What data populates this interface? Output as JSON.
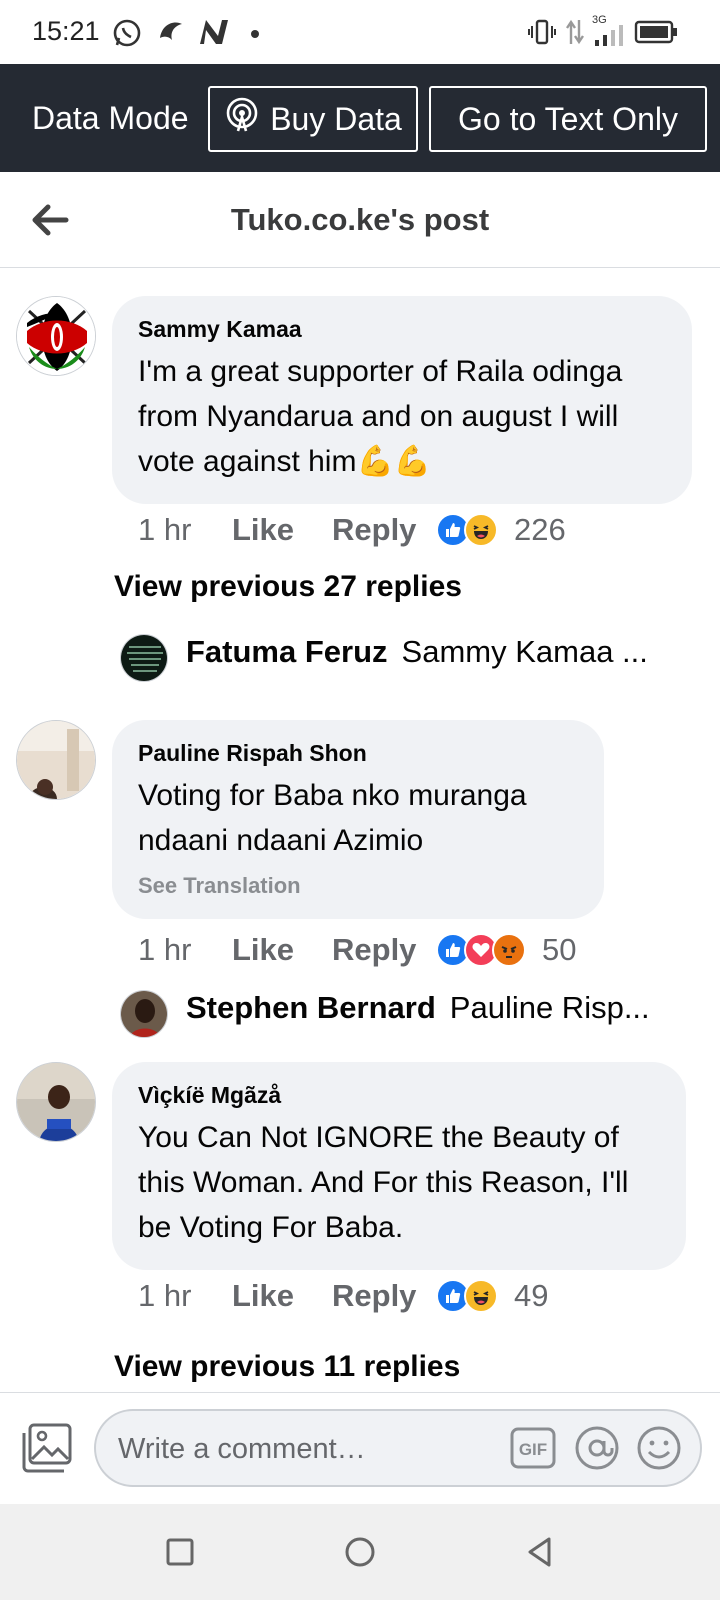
{
  "status_bar": {
    "time": "15:21",
    "network_label": "3G",
    "icons": [
      "whatsapp-icon",
      "hearthstone-icon",
      "n-app-icon",
      "dot-icon",
      "vibrate-icon",
      "data-arrows-icon",
      "signal-icon",
      "battery-icon"
    ]
  },
  "data_bar": {
    "mode_label": "Data Mode",
    "buy_data_label": "Buy Data",
    "text_only_label": "Go to Text Only"
  },
  "header": {
    "title": "Tuko.co.ke's post"
  },
  "comments": [
    {
      "author": "Sammy Kamaa",
      "text": "I'm a great supporter of Raila odinga from Nyandarua and on august I will vote against him💪💪",
      "time": "1 hr",
      "like_label": "Like",
      "reply_label": "Reply",
      "reactions": [
        "like",
        "haha"
      ],
      "reaction_count": "226",
      "view_previous": "View previous 27 replies",
      "reply_preview": {
        "name": "Fatuma Feruz",
        "text": "Sammy Kamaa ..."
      }
    },
    {
      "author": "Pauline Rispah Shon",
      "text": "Voting for Baba nko muranga ndaani ndaani Azimio",
      "see_translation": "See Translation",
      "time": "1 hr",
      "like_label": "Like",
      "reply_label": "Reply",
      "reactions": [
        "like",
        "love",
        "angry"
      ],
      "reaction_count": "50",
      "reply_preview": {
        "name": "Stephen Bernard",
        "text": "Pauline Risp..."
      }
    },
    {
      "author": "Vìçkíë Mgãzå",
      "text": "You Can Not IGNORE the Beauty of this Woman. And For this Reason, I'll be Voting For Baba.",
      "time": "1 hr",
      "like_label": "Like",
      "reply_label": "Reply",
      "reactions": [
        "like",
        "haha"
      ],
      "reaction_count": "49",
      "view_previous": "View previous 11 replies"
    }
  ],
  "composer": {
    "placeholder": "Write a comment…",
    "gif_label": "GIF"
  },
  "colors": {
    "data_bar_bg": "#252a33",
    "bubble_bg": "#f0f2f5",
    "like_blue": "#1877f2",
    "haha_yellow": "#f7b928",
    "love_red": "#f33e58",
    "angry_orange": "#e9710f"
  }
}
